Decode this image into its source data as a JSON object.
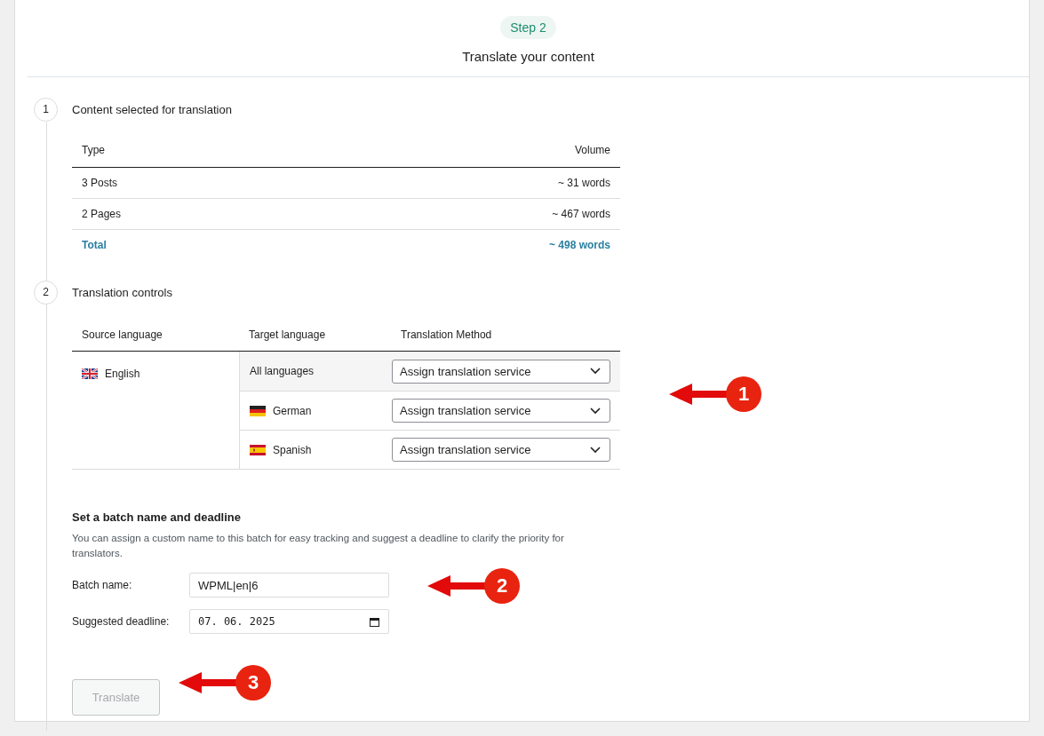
{
  "step_badge": "Step 2",
  "title": "Translate your content",
  "sections": [
    {
      "number": "1",
      "heading": "Content selected for translation"
    },
    {
      "number": "2",
      "heading": "Translation controls"
    }
  ],
  "content_table": {
    "columns": [
      "Type",
      "Volume"
    ],
    "rows": [
      {
        "type": "3 Posts",
        "volume": "~ 31 words",
        "kind": "item"
      },
      {
        "type": "2 Pages",
        "volume": "~ 467 words",
        "kind": "item"
      },
      {
        "type": "Total",
        "volume": "~ 498 words",
        "kind": "total"
      }
    ]
  },
  "controls_table": {
    "columns": [
      "Source language",
      "Target language",
      "Translation Method"
    ],
    "source": {
      "language": "English"
    },
    "targets": [
      {
        "language": "All languages",
        "kind": "all",
        "method": "Assign translation service"
      },
      {
        "language": "German",
        "kind": "language",
        "method": "Assign translation service"
      },
      {
        "language": "Spanish",
        "kind": "language",
        "method": "Assign translation service"
      }
    ]
  },
  "batch": {
    "heading": "Set a batch name and deadline",
    "description": "You can assign a custom name to this batch for easy tracking and suggest a deadline to clarify the priority for translators.",
    "fields": [
      {
        "label": "Batch name:",
        "value": "WPML|en|6",
        "kind": "text"
      },
      {
        "label": "Suggested deadline:",
        "value": "07. 06. 2025",
        "kind": "date"
      }
    ]
  },
  "translate_button": {
    "label": "Translate",
    "disabled": true
  },
  "annotations": [
    {
      "number": "1"
    },
    {
      "number": "2"
    },
    {
      "number": "3"
    }
  ]
}
